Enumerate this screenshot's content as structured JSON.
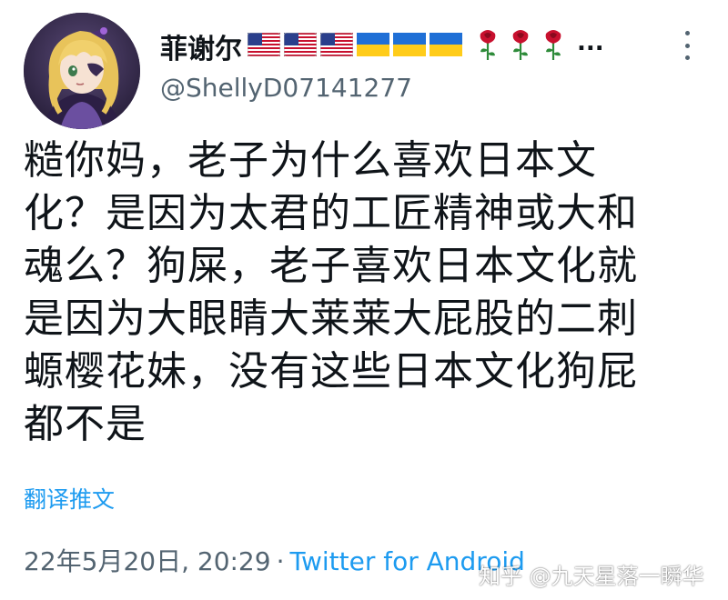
{
  "tweet": {
    "display_name": "菲谢尔",
    "handle": "@ShellyD07141277",
    "ellipsis": "...",
    "body_lines": [
      "糙你妈，老子为什么喜欢日本文",
      "化？是因为太君的工匠精神或大和",
      "魂么？狗屎，老子喜欢日本文化就",
      "是因为大眼睛大莱莱大屁股的二刺",
      "螈樱花妹，没有这些日本文化狗屁",
      "都不是"
    ],
    "translate_label": "翻译推文",
    "timestamp": "22年5月20日, 20:29",
    "separator": "·",
    "source": "Twitter for Android"
  },
  "watermark": "知乎 @九天星落一瞬华",
  "icons": {
    "flags": [
      "us-flag-icon",
      "us-flag-icon",
      "us-flag-icon",
      "ukraine-flag-icon",
      "ukraine-flag-icon",
      "ukraine-flag-icon"
    ],
    "roses": [
      "rose-icon",
      "rose-icon",
      "rose-icon"
    ],
    "more": "more-vertical-icon"
  },
  "colors": {
    "link_blue": "#1d9bf0",
    "secondary_gray": "#536471",
    "text": "#0f1419"
  }
}
